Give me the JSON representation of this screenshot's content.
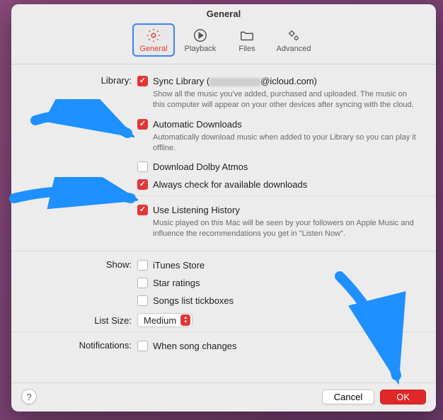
{
  "title": "General",
  "tabs": [
    {
      "id": "general",
      "label": "General"
    },
    {
      "id": "playback",
      "label": "Playback"
    },
    {
      "id": "files",
      "label": "Files"
    },
    {
      "id": "advanced",
      "label": "Advanced"
    }
  ],
  "sections": {
    "library": {
      "label": "Library:",
      "sync": {
        "checked": true,
        "label_prefix": "Sync Library (",
        "label_suffix": "@icloud.com)",
        "desc": "Show all the music you've added, purchased and uploaded. The music on this computer will appear on your other devices after syncing with the cloud."
      },
      "auto_dl": {
        "checked": true,
        "label": "Automatic Downloads",
        "desc": "Automatically download music when added to your Library so you can play it offline."
      },
      "dolby": {
        "checked": false,
        "label": "Download Dolby Atmos"
      },
      "avail": {
        "checked": true,
        "label": "Always check for available downloads"
      }
    },
    "history": {
      "checked": true,
      "label": "Use Listening History",
      "desc": "Music played on this Mac will be seen by your followers on Apple Music and influence the recommendations you get in \"Listen Now\"."
    },
    "show": {
      "label": "Show:",
      "itunes": {
        "checked": false,
        "label": "iTunes Store"
      },
      "star": {
        "checked": false,
        "label": "Star ratings"
      },
      "tick": {
        "checked": false,
        "label": "Songs list tickboxes"
      }
    },
    "list_size": {
      "label": "List Size:",
      "value": "Medium"
    },
    "notifications": {
      "label": "Notifications:",
      "song_change": {
        "checked": false,
        "label": "When song changes"
      }
    }
  },
  "footer": {
    "help": "?",
    "cancel": "Cancel",
    "ok": "OK"
  }
}
